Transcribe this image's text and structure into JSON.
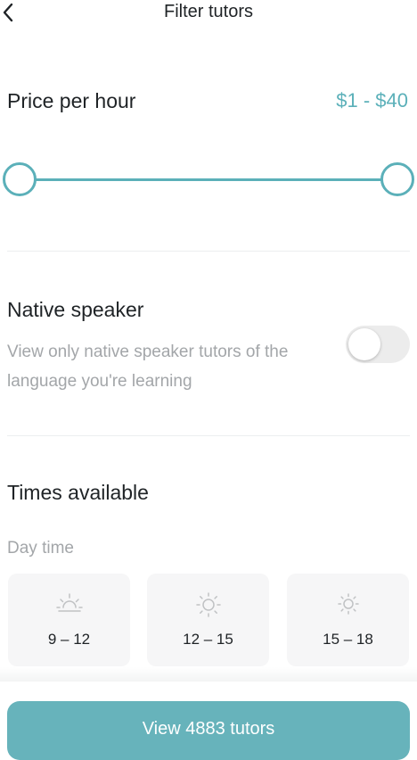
{
  "header": {
    "title": "Filter tutors",
    "back_icon": "chevron-left-icon"
  },
  "price": {
    "label": "Price per hour",
    "range_text": "$1 - $40",
    "min_value": 1,
    "max_value": 40
  },
  "native": {
    "title": "Native speaker",
    "description": "View only native speaker tutors of the language you're learning",
    "enabled": false
  },
  "times": {
    "title": "Times available",
    "section_label": "Day time",
    "slots": [
      {
        "label": "9 – 12",
        "icon": "sunrise-icon"
      },
      {
        "label": "12 – 15",
        "icon": "sun-icon"
      },
      {
        "label": "15 – 18",
        "icon": "sun-small-icon"
      }
    ]
  },
  "cta": {
    "label": "View 4883 tutors"
  },
  "colors": {
    "accent": "#5bb0b9",
    "button": "#67b3bb",
    "muted_text": "#a3a6a9",
    "tile_bg": "#f6f6f7"
  }
}
